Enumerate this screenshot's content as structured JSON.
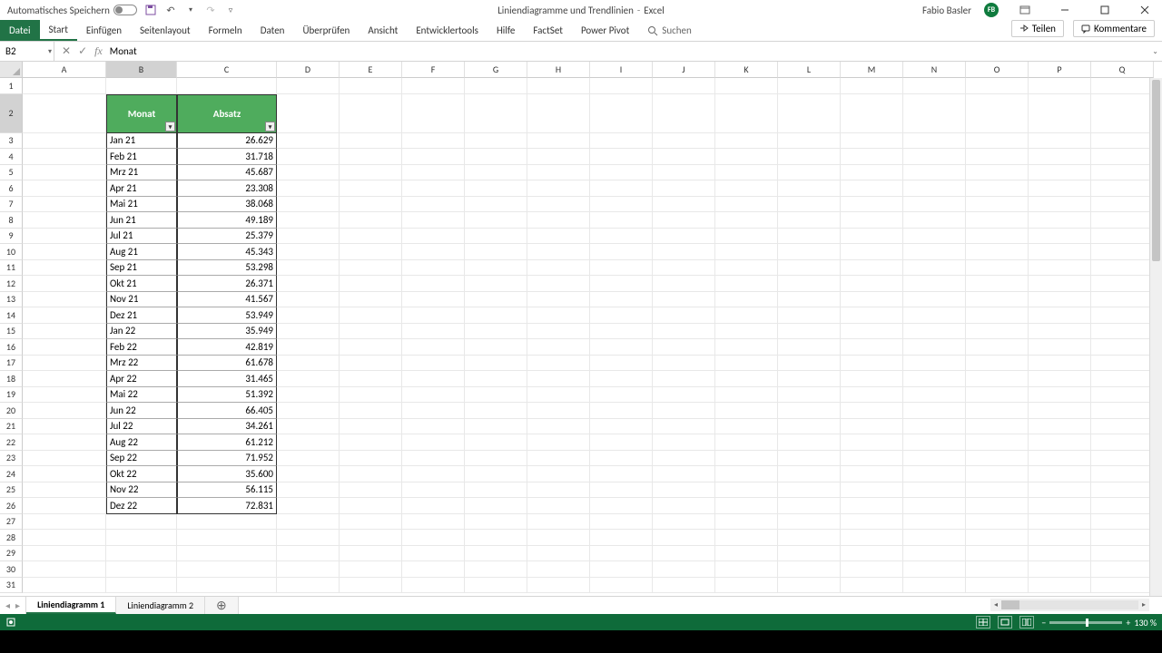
{
  "titlebar": {
    "autosave_label": "Automatisches Speichern",
    "doc_title": "Liniendiagramme und Trendlinien",
    "app_name": "Excel",
    "username": "Fabio Basler",
    "user_initials": "FB"
  },
  "ribbon": {
    "tabs": [
      "Datei",
      "Start",
      "Einfügen",
      "Seitenlayout",
      "Formeln",
      "Daten",
      "Überprüfen",
      "Ansicht",
      "Entwicklertools",
      "Hilfe",
      "FactSet",
      "Power Pivot"
    ],
    "search_placeholder": "Suchen",
    "share_label": "Teilen",
    "comments_label": "Kommentare"
  },
  "formula_bar": {
    "cell_ref": "B2",
    "content": "Monat"
  },
  "columns": [
    "A",
    "B",
    "C",
    "D",
    "E",
    "F",
    "G",
    "H",
    "I",
    "J",
    "K",
    "L",
    "M",
    "N",
    "O",
    "P",
    "Q"
  ],
  "table": {
    "headers": {
      "month": "Monat",
      "sales": "Absatz"
    },
    "rows": [
      {
        "month": "Jan 21",
        "sales": "26.629"
      },
      {
        "month": "Feb 21",
        "sales": "31.718"
      },
      {
        "month": "Mrz 21",
        "sales": "45.687"
      },
      {
        "month": "Apr 21",
        "sales": "23.308"
      },
      {
        "month": "Mai 21",
        "sales": "38.068"
      },
      {
        "month": "Jun 21",
        "sales": "49.189"
      },
      {
        "month": "Jul 21",
        "sales": "25.379"
      },
      {
        "month": "Aug 21",
        "sales": "45.343"
      },
      {
        "month": "Sep 21",
        "sales": "53.298"
      },
      {
        "month": "Okt 21",
        "sales": "26.371"
      },
      {
        "month": "Nov 21",
        "sales": "41.567"
      },
      {
        "month": "Dez 21",
        "sales": "53.949"
      },
      {
        "month": "Jan 22",
        "sales": "35.949"
      },
      {
        "month": "Feb 22",
        "sales": "42.819"
      },
      {
        "month": "Mrz 22",
        "sales": "61.678"
      },
      {
        "month": "Apr 22",
        "sales": "31.465"
      },
      {
        "month": "Mai 22",
        "sales": "51.392"
      },
      {
        "month": "Jun 22",
        "sales": "66.405"
      },
      {
        "month": "Jul 22",
        "sales": "34.261"
      },
      {
        "month": "Aug 22",
        "sales": "61.212"
      },
      {
        "month": "Sep 22",
        "sales": "71.952"
      },
      {
        "month": "Okt 22",
        "sales": "35.600"
      },
      {
        "month": "Nov 22",
        "sales": "56.115"
      },
      {
        "month": "Dez 22",
        "sales": "72.831"
      }
    ]
  },
  "sheets": {
    "active": "Liniendiagramm 1",
    "other": "Liniendiagramm 2"
  },
  "statusbar": {
    "zoom": "130 %"
  },
  "chart_data": {
    "type": "table",
    "title": "Monat / Absatz",
    "columns": [
      "Monat",
      "Absatz"
    ],
    "series": [
      {
        "name": "Absatz",
        "x": [
          "Jan 21",
          "Feb 21",
          "Mrz 21",
          "Apr 21",
          "Mai 21",
          "Jun 21",
          "Jul 21",
          "Aug 21",
          "Sep 21",
          "Okt 21",
          "Nov 21",
          "Dez 21",
          "Jan 22",
          "Feb 22",
          "Mrz 22",
          "Apr 22",
          "Mai 22",
          "Jun 22",
          "Jul 22",
          "Aug 22",
          "Sep 22",
          "Okt 22",
          "Nov 22",
          "Dez 22"
        ],
        "values": [
          26629,
          31718,
          45687,
          23308,
          38068,
          49189,
          25379,
          45343,
          53298,
          26371,
          41567,
          53949,
          35949,
          42819,
          61678,
          31465,
          51392,
          66405,
          34261,
          61212,
          71952,
          35600,
          56115,
          72831
        ]
      }
    ]
  }
}
